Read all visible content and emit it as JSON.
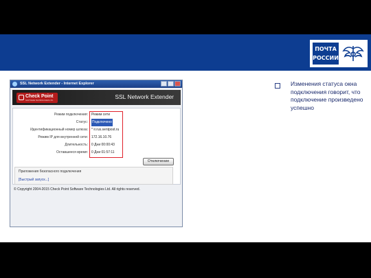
{
  "logo": {
    "line1": "ПОЧТА",
    "line2": "РОССИИ"
  },
  "window": {
    "title": "SSL Network Extender - Internet Explorer",
    "brand": "Check Point",
    "brand_sub": "SOFTWARE TECHNOLOGIES LTD.",
    "product": "SSL Network Extender",
    "rows": [
      {
        "label": "Режим подключения:",
        "value": "Режим сети"
      },
      {
        "label": "Статус:",
        "value": "Подключено"
      },
      {
        "label": "Идентификационный номер шлюза:",
        "value": "* ir.rus.sentpost.ru"
      },
      {
        "label": "Режим IP для внутренней сети:",
        "value": "172.16.10.76"
      },
      {
        "label": "Длительность:",
        "value": "0 Дни 00:00:43"
      },
      {
        "label": "Оставшееся время:",
        "value": "0 Дни 01:57:11"
      }
    ],
    "disconnect_label": "Отключение",
    "apps_title": "Приложения безопасного подключения",
    "apps_link": "[Быстрый запуск...]",
    "copyright": "© Copyright 2004-2015 Check Point Software Technologies Ltd. All rights reserved."
  },
  "note": {
    "text": "Изменения статуса окна подключения говорит, что подключение произведено успешно"
  },
  "colors": {
    "header_band": "#0d3d91",
    "highlight_box": "#e0202a",
    "selected_value": "#2b59b6"
  }
}
